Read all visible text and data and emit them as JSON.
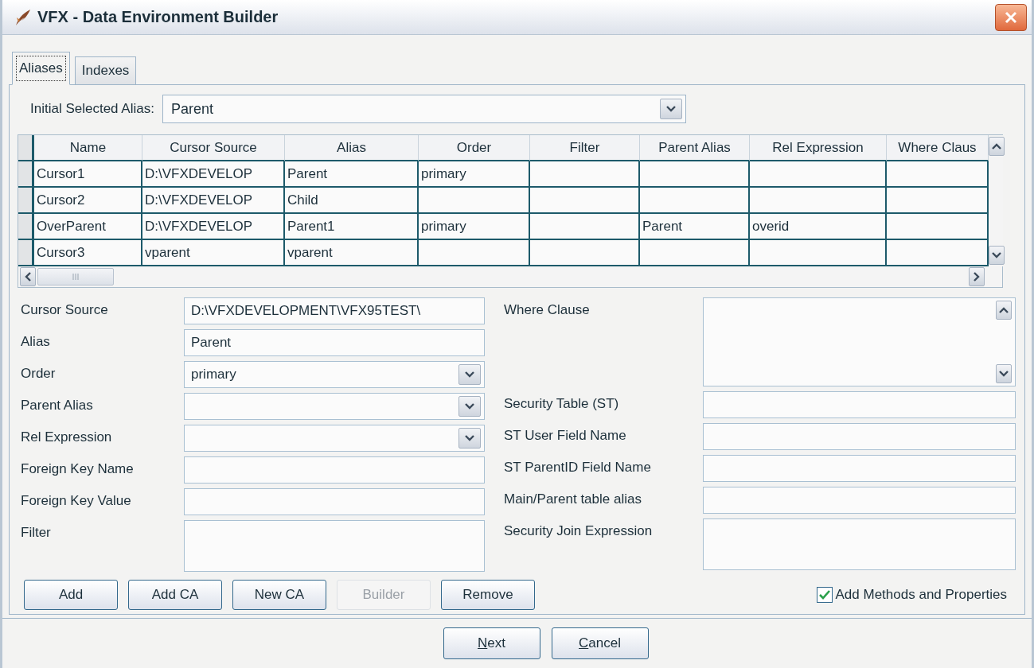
{
  "window": {
    "title": "VFX - Data Environment Builder"
  },
  "tabs": [
    {
      "label": "Aliases",
      "selected": true
    },
    {
      "label": "Indexes",
      "selected": false
    }
  ],
  "initial_alias": {
    "label": "Initial Selected Alias:",
    "value": "Parent"
  },
  "table": {
    "columns": [
      "Name",
      "Cursor Source",
      "Alias",
      "Order",
      "Filter",
      "Parent Alias",
      "Rel Expression",
      "Where Claus"
    ],
    "rows": [
      {
        "cells": [
          "Cursor1",
          "D:\\VFXDEVELOP",
          "Parent",
          "primary",
          null,
          null,
          null,
          null
        ]
      },
      {
        "cells": [
          "Cursor2",
          "D:\\VFXDEVELOP",
          "Child",
          null,
          null,
          null,
          null,
          null
        ]
      },
      {
        "cells": [
          "OverParent",
          "D:\\VFXDEVELOP",
          "Parent1",
          "primary",
          null,
          "Parent",
          "overid",
          null
        ]
      },
      {
        "cells": [
          "Cursor3",
          "vparent",
          "vparent",
          null,
          null,
          null,
          null,
          null
        ]
      }
    ]
  },
  "form_left": [
    {
      "label": "Cursor Source",
      "kind": "text",
      "value": "D:\\VFXDEVELOPMENT\\VFX95TEST\\"
    },
    {
      "label": "Alias",
      "kind": "text",
      "value": "Parent"
    },
    {
      "label": "Order",
      "kind": "combo",
      "value": "primary"
    },
    {
      "label": "Parent Alias",
      "kind": "combo"
    },
    {
      "label": "Rel Expression",
      "kind": "combo"
    },
    {
      "label": "Foreign Key Name",
      "kind": "text"
    },
    {
      "label": "Foreign Key Value",
      "kind": "text"
    },
    {
      "label": "Filter",
      "kind": "memo"
    }
  ],
  "form_right": [
    {
      "label": "Where Clause",
      "kind": "scrollmemo"
    },
    {
      "label": "Security Table (ST)",
      "kind": "text"
    },
    {
      "label": "ST User Field Name",
      "kind": "text"
    },
    {
      "label": "ST ParentID Field Name",
      "kind": "text"
    },
    {
      "label": "Main/Parent table alias",
      "kind": "text"
    },
    {
      "label": "Security Join Expression",
      "kind": "memo"
    }
  ],
  "buttons": [
    {
      "label": "Add",
      "disabled": false
    },
    {
      "label": "Add CA",
      "disabled": false
    },
    {
      "label": "New CA",
      "disabled": false
    },
    {
      "label": "Builder",
      "disabled": true
    },
    {
      "label": "Remove",
      "disabled": false
    }
  ],
  "checkbox": {
    "label": "Add Methods and Properties",
    "checked": true
  },
  "footer_buttons": [
    {
      "label": "Next",
      "mnemonic": true
    },
    {
      "label": "Cancel",
      "mnemonic": true
    }
  ]
}
